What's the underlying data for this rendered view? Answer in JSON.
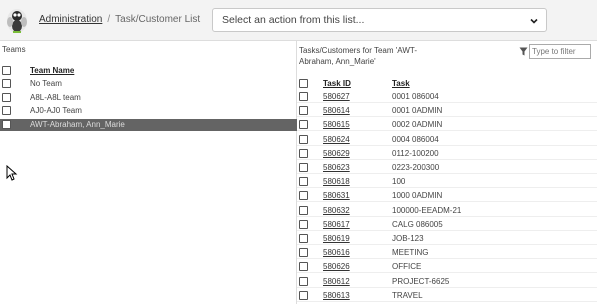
{
  "header": {
    "breadcrumb_root": "Administration",
    "breadcrumb_sep": "/",
    "breadcrumb_current": "Task/Customer List",
    "action_select": "Select an action from this list...",
    "logo_icon": "fly-mascot-logo"
  },
  "teams": {
    "title": "Teams",
    "column": "Team Name",
    "rows": [
      {
        "name": "No Team",
        "selected": false
      },
      {
        "name": "A8L-A8L team",
        "selected": false
      },
      {
        "name": "AJ0-AJ0 Team",
        "selected": false
      },
      {
        "name": "AWT-Abraham, Ann_Marie",
        "selected": true
      }
    ]
  },
  "tasks": {
    "title": "Tasks/Customers for Team 'AWT-Abraham, Ann_Marie'",
    "filter_placeholder": "Type to filter",
    "col_id": "Task ID",
    "col_task": "Task",
    "rows": [
      {
        "id": "580627",
        "task": "0001 086004"
      },
      {
        "id": "580614",
        "task": "0001 0ADMIN"
      },
      {
        "id": "580615",
        "task": "0002 0ADMIN"
      },
      {
        "id": "580624",
        "task": "0004 086004"
      },
      {
        "id": "580629",
        "task": "0112-100200"
      },
      {
        "id": "580623",
        "task": "0223-200300"
      },
      {
        "id": "580618",
        "task": "100"
      },
      {
        "id": "580631",
        "task": "1000 0ADMIN"
      },
      {
        "id": "580632",
        "task": "100000-EEADM-21"
      },
      {
        "id": "580617",
        "task": "CALG 086005"
      },
      {
        "id": "580619",
        "task": "JOB-123"
      },
      {
        "id": "580616",
        "task": "MEETING"
      },
      {
        "id": "580626",
        "task": "OFFICE"
      },
      {
        "id": "580612",
        "task": "PROJECT-6625"
      },
      {
        "id": "580613",
        "task": "TRAVEL"
      }
    ]
  },
  "colors": {
    "selected_row": "#646464",
    "topbar": "#f3f3f3"
  }
}
